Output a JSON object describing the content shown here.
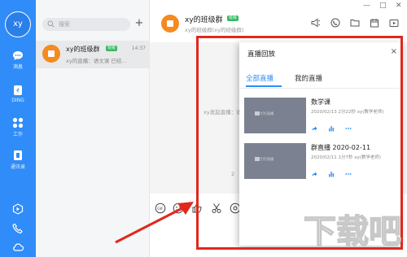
{
  "rail": {
    "avatar_text": "xy",
    "nav": [
      {
        "label": "消息",
        "icon": "chat-bubble-icon"
      },
      {
        "label": "DING",
        "icon": "ding-icon"
      },
      {
        "label": "工作",
        "icon": "apps-grid-icon"
      },
      {
        "label": "通讯录",
        "icon": "contacts-icon"
      }
    ],
    "bottom_icons": [
      "play-icon",
      "phone-icon",
      "cloud-icon"
    ]
  },
  "conversation_list": {
    "search_placeholder": "搜索",
    "add_icon": "+",
    "items": [
      {
        "name": "xy的班级群",
        "badge": "班级",
        "time": "14:37",
        "preview": "xy的直播：语文课 已结..."
      }
    ]
  },
  "chat": {
    "title": "xy的班级群",
    "badge": "班级",
    "subtitle": "xy的班级群(xy的班级群)",
    "header_icons": [
      "announcement-icon",
      "phone-call-icon",
      "folder-icon",
      "calendar-icon",
      "live-icon"
    ],
    "window_controls": [
      "—",
      "□",
      "✕"
    ],
    "messages": [
      "xy发起直播：语文课",
      "2"
    ],
    "toolbar_icons": [
      "gif-icon",
      "emoji-icon",
      "thumbs-up-icon",
      "scissors-icon",
      "at-icon"
    ]
  },
  "replay_panel": {
    "title": "直播回放",
    "close": "×",
    "tabs": [
      {
        "label": "全部直播",
        "active": true
      },
      {
        "label": "我的直播",
        "active": false
      }
    ],
    "items": [
      {
        "title": "数学课",
        "meta": "2020/02/13 2分22秒 xy(教学老师)",
        "thumb_text": "钉钉直播"
      },
      {
        "title": "群直播 2020-02-11",
        "meta": "2020/02/11 1分7秒 xy(教学老师)",
        "thumb_text": "钉钉直播"
      }
    ]
  },
  "colors": {
    "accent": "#2f8cf8",
    "annotation": "#e0281e",
    "group_icon": "#f58a1f"
  },
  "watermark": "下载吧"
}
